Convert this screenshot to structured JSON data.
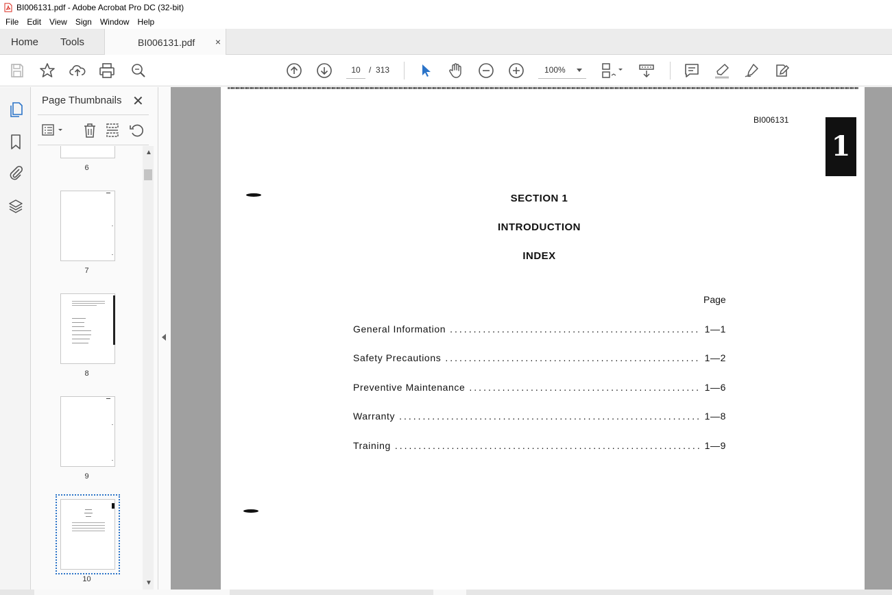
{
  "window": {
    "title": "BI006131.pdf - Adobe Acrobat Pro DC (32-bit)"
  },
  "menu": [
    "File",
    "Edit",
    "View",
    "Sign",
    "Window",
    "Help"
  ],
  "tabs": {
    "home": "Home",
    "tools": "Tools",
    "document": "BI006131.pdf",
    "close": "×"
  },
  "toolbar": {
    "current_page": "10",
    "page_separator": "/",
    "total_pages": "313",
    "zoom": "100%"
  },
  "thumbnails_panel": {
    "title": "Page Thumbnails",
    "close": "✕",
    "pages": [
      {
        "number": "6"
      },
      {
        "number": "7"
      },
      {
        "number": "8"
      },
      {
        "number": "9"
      },
      {
        "number": "10",
        "selected": true
      }
    ]
  },
  "document": {
    "doc_id": "BI006131",
    "tab_marker": "1",
    "headings": [
      "SECTION 1",
      "INTRODUCTION",
      "INDEX"
    ],
    "page_column_label": "Page",
    "toc": [
      {
        "label": "General Information",
        "page": "1—1"
      },
      {
        "label": "Safety Precautions",
        "page": "1—2"
      },
      {
        "label": "Preventive Maintenance",
        "page": "1—6"
      },
      {
        "label": "Warranty",
        "page": "1—8"
      },
      {
        "label": "Training",
        "page": "1—9"
      }
    ]
  },
  "colors": {
    "accent": "#2a73c8",
    "pdf_red": "#d9281c",
    "canvas": "#a0a0a0"
  }
}
